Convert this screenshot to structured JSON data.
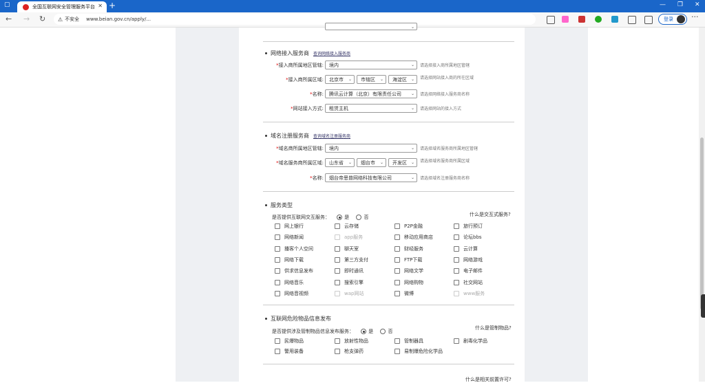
{
  "browser": {
    "tab_title": "全国互联网安全管理服务平台",
    "insecure_label": "不安全",
    "url": "www.beian.gov.cn/apply/...",
    "login_label": "登录"
  },
  "isp_section": {
    "title": "网络接入服务商",
    "link": "查询网络接入服务商",
    "fields": [
      {
        "label": "接入商所属地区管辖:",
        "value": "境内",
        "hint": "请选择接入商所属地区管辖"
      },
      {
        "label": "接入商所属区域:",
        "values": [
          "北京市",
          "市辖区",
          "海淀区"
        ],
        "hint": "请选择网站接入商的所在区域"
      },
      {
        "label": "名称:",
        "value": "腾讯云计算（北京）有限责任公司",
        "hint": "请选择网络接入服务商名称"
      },
      {
        "label": "网站接入方式:",
        "value": "租赁主机",
        "hint": "请选择网站的接入方式"
      }
    ]
  },
  "domain_section": {
    "title": "域名注册服务商",
    "link": "查询域名注册服务商",
    "fields": [
      {
        "label": "域名商所属地区管辖:",
        "value": "境内",
        "hint": "请选择域名服务商所属地区管辖"
      },
      {
        "label": "域名服务商所属区域:",
        "values": [
          "山东省",
          "烟台市",
          "开发区"
        ],
        "hint": "请选择域名服务商所属区域"
      },
      {
        "label": "名称:",
        "value": "烟台帝思普网络科技有限公司",
        "hint": "请选择域名注册服务商名称"
      }
    ]
  },
  "service_section": {
    "title": "服务类型",
    "question": "是否提供互联网交互服务：",
    "yes": "是",
    "no": "否",
    "what_link": "什么是交互式服务?",
    "items": [
      [
        "网上银行",
        "云存储",
        "P2P金融",
        "旅行预订"
      ],
      [
        "网络新闻",
        "app服务",
        "移动应用商店",
        "论坛bbs"
      ],
      [
        "播客个人空间",
        "聊天室",
        "财经服务",
        "云计算"
      ],
      [
        "网络下载",
        "第三方支付",
        "FTP下载",
        "网络游戏"
      ],
      [
        "供求信息发布",
        "即时通讯",
        "网络文学",
        "电子邮件"
      ],
      [
        "网络音乐",
        "搜索引擎",
        "网络购物",
        "社交网站"
      ],
      [
        "网络音视频",
        "wap网站",
        "微博",
        "www服务"
      ]
    ]
  },
  "danger_section": {
    "title": "互联网危险物品信息发布",
    "question": "是否提供涉及管制物品信息发布服务：",
    "yes": "是",
    "no": "否",
    "what_link": "什么是管制物品?",
    "items": [
      [
        "民爆物品",
        "放射性物品",
        "管制器具",
        "剧毒化学品"
      ],
      [
        "警用装备",
        "枪支弹药",
        "易制爆危险化学品"
      ]
    ]
  },
  "bottom_partial": {
    "what_link": "什么是相关前置许可?"
  }
}
